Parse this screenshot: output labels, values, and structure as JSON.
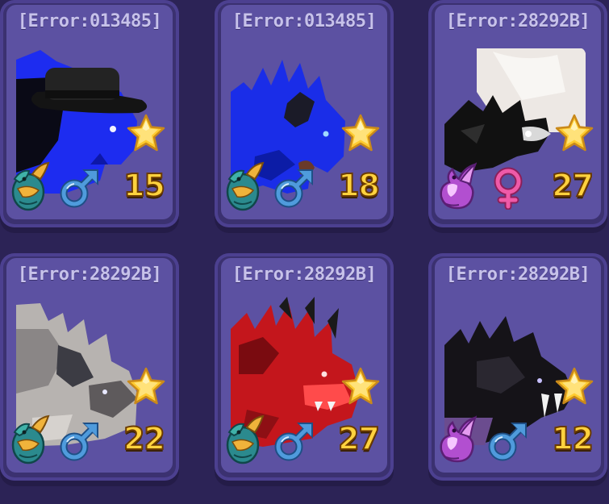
{
  "pets": [
    {
      "title": "[Error:013485]",
      "level": "15",
      "gender": "male",
      "egg": "dragon-egg-teal",
      "art": "blue-hat"
    },
    {
      "title": "[Error:013485]",
      "level": "18",
      "gender": "male",
      "egg": "dragon-egg-teal",
      "art": "blue-spiky"
    },
    {
      "title": "[Error:28292B]",
      "level": "27",
      "gender": "female",
      "egg": "dragon-purple",
      "art": "white-black"
    },
    {
      "title": "[Error:28292B]",
      "level": "22",
      "gender": "male",
      "egg": "dragon-egg-teal",
      "art": "gray"
    },
    {
      "title": "[Error:28292B]",
      "level": "27",
      "gender": "male",
      "egg": "dragon-egg-teal",
      "art": "red"
    },
    {
      "title": "[Error:28292B]",
      "level": "12",
      "gender": "male",
      "egg": "dragon-purple",
      "art": "black"
    }
  ],
  "colors": {
    "background": "#2c2356",
    "card": "#5c51a2",
    "level_text": "#ffd23e",
    "male_icon": "#4f9bdc",
    "female_icon": "#ef5aa8",
    "star": "#ffcb2e"
  }
}
